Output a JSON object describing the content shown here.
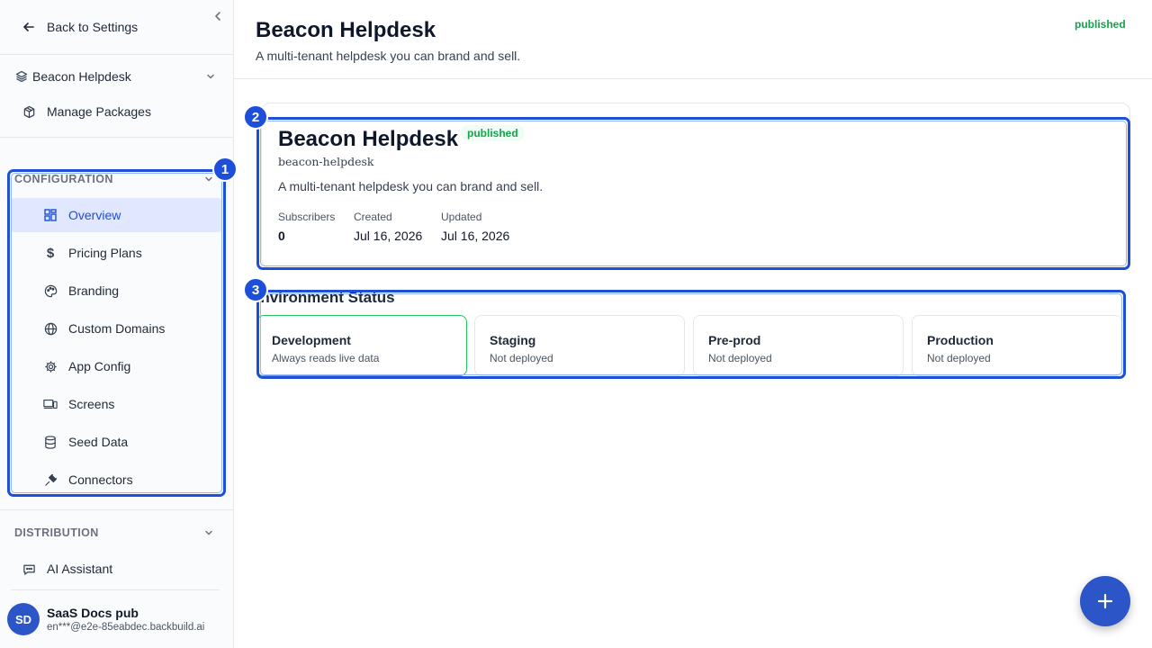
{
  "sidebar": {
    "back_label": "Back to Settings",
    "package_select": "Beacon Helpdesk",
    "manage_packages": "Manage Packages",
    "configuration_header": "CONFIGURATION",
    "config_items": [
      {
        "label": "Overview",
        "icon": "layout-grid-icon",
        "active": true
      },
      {
        "label": "Pricing Plans",
        "icon": "dollar-icon",
        "active": false
      },
      {
        "label": "Branding",
        "icon": "palette-icon",
        "active": false
      },
      {
        "label": "Custom Domains",
        "icon": "globe-icon",
        "active": false
      },
      {
        "label": "App Config",
        "icon": "gear-icon",
        "active": false
      },
      {
        "label": "Screens",
        "icon": "devices-icon",
        "active": false
      },
      {
        "label": "Seed Data",
        "icon": "database-icon",
        "active": false
      },
      {
        "label": "Connectors",
        "icon": "plug-icon",
        "active": false
      }
    ],
    "distribution_header": "DISTRIBUTION",
    "ai_assistant": "AI Assistant",
    "user": {
      "initials": "SD",
      "name": "SaaS Docs pub",
      "email": "en***@e2e-85eabdec.backbuild.ai"
    }
  },
  "header": {
    "title": "Beacon Helpdesk",
    "subtitle": "A multi-tenant helpdesk you can brand and sell.",
    "status": "published"
  },
  "package": {
    "name": "Beacon Helpdesk",
    "status": "published",
    "slug": "beacon-helpdesk",
    "description": "A multi-tenant helpdesk you can brand and sell.",
    "stats": {
      "subscribers_label": "Subscribers",
      "subscribers_value": "0",
      "created_label": "Created",
      "created_value": "Jul 16, 2026",
      "updated_label": "Updated",
      "updated_value": "Jul 16, 2026"
    }
  },
  "environments": {
    "title": "Environment Status",
    "items": [
      {
        "name": "Development",
        "status": "Always reads live data"
      },
      {
        "name": "Staging",
        "status": "Not deployed"
      },
      {
        "name": "Pre-prod",
        "status": "Not deployed"
      },
      {
        "name": "Production",
        "status": "Not deployed"
      }
    ]
  },
  "annotations": [
    "1",
    "2",
    "3"
  ],
  "colors": {
    "accent": "#2c56c8",
    "highlight": "#1e4fd8",
    "success": "#16a34a",
    "active_bg": "#e0e7ff"
  }
}
